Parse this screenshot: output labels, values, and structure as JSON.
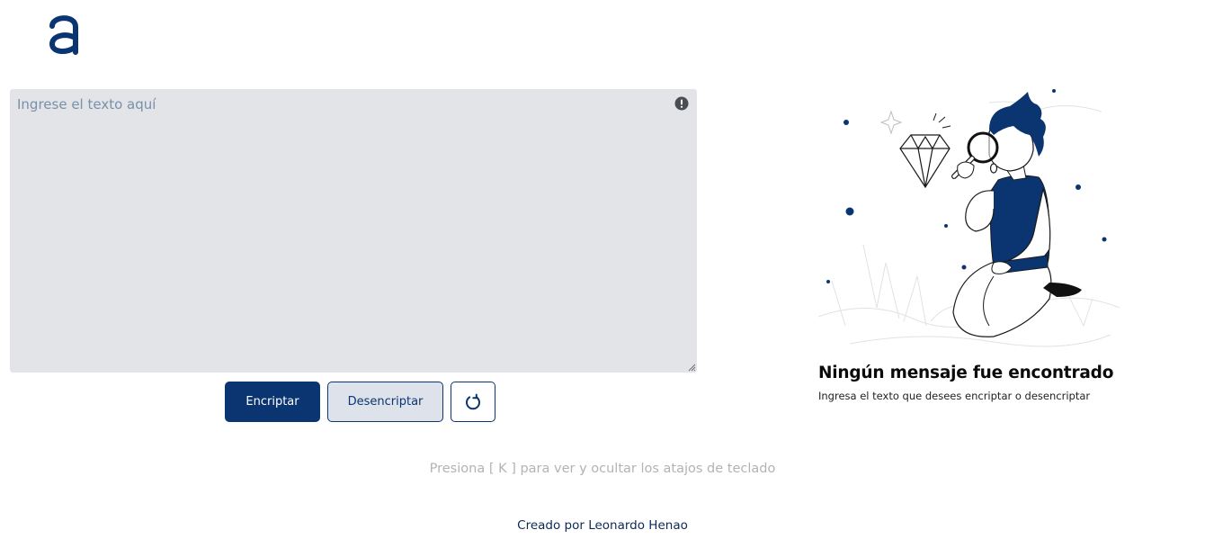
{
  "logo": {
    "icon": "brand-a-logo",
    "color": "#0b3571"
  },
  "editor": {
    "placeholder": "Ingrese el texto aquí",
    "value": "",
    "info_icon": "exclamation-circle-icon"
  },
  "actions": {
    "encrypt_label": "Encriptar",
    "decrypt_label": "Desencriptar",
    "reset_icon": "refresh-icon"
  },
  "empty_state": {
    "title": "Ningún mensaje fue encontrado",
    "subtitle": "Ingresa el texto que desees encriptar o desencriptar",
    "illustration": "person-with-magnifying-glass-illustration"
  },
  "shortcut_hint": "Presiona [ K ] para ver y ocultar los atajos de teclado",
  "footer": {
    "credit": "Creado por Leonardo Henao"
  },
  "colors": {
    "primary": "#0b3571",
    "editor_bg": "#e3e4e7",
    "secondary_btn_bg": "#dde2eb",
    "hint_text": "#b3b3b3"
  }
}
